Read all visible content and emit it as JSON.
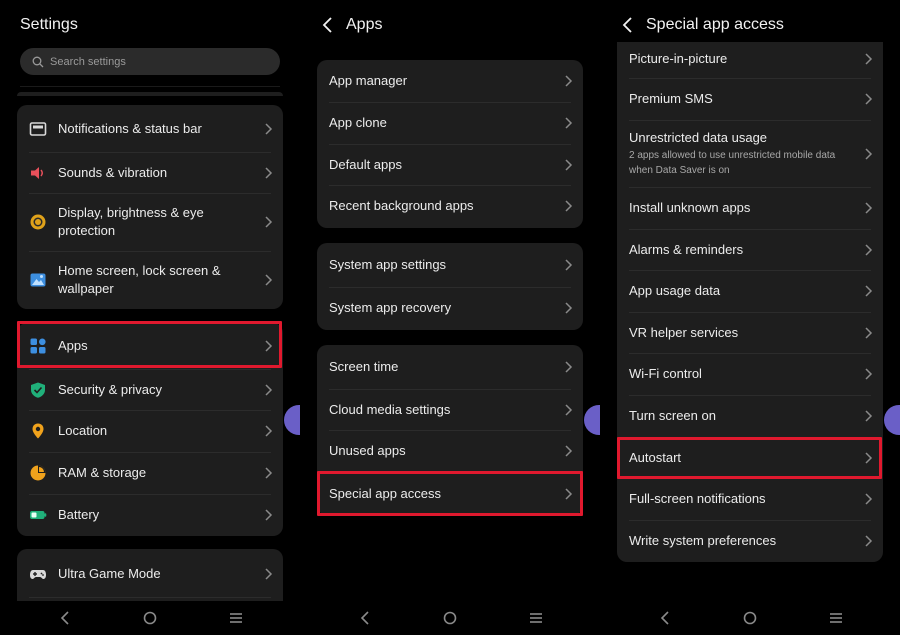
{
  "panel1": {
    "title": "Settings",
    "search_placeholder": "Search settings",
    "group1": [
      {
        "label": "Notifications & status bar",
        "icon": "notification-bar-icon"
      },
      {
        "label": "Sounds & vibration",
        "icon": "speaker-icon"
      },
      {
        "label": "Display, brightness & eye protection",
        "icon": "brightness-icon"
      },
      {
        "label": "Home screen, lock screen & wallpaper",
        "icon": "wallpaper-icon"
      }
    ],
    "group2": [
      {
        "label": "Apps",
        "icon": "apps-icon"
      },
      {
        "label": "Security & privacy",
        "icon": "shield-icon"
      },
      {
        "label": "Location",
        "icon": "location-pin-icon"
      },
      {
        "label": "RAM & storage",
        "icon": "storage-pie-icon"
      },
      {
        "label": "Battery",
        "icon": "battery-icon"
      }
    ],
    "group3": [
      {
        "label": "Ultra Game Mode",
        "icon": "gamepad-icon"
      }
    ]
  },
  "panel2": {
    "title": "Apps",
    "group1": [
      "App manager",
      "App clone",
      "Default apps",
      "Recent background apps"
    ],
    "group2": [
      "System app settings",
      "System app recovery"
    ],
    "group3": [
      "Screen time",
      "Cloud media settings",
      "Unused apps",
      "Special app access"
    ]
  },
  "panel3": {
    "title": "Special app access",
    "items": [
      {
        "label": "Picture-in-picture"
      },
      {
        "label": "Premium SMS"
      },
      {
        "label": "Unrestricted data usage",
        "sub": "2 apps allowed to use unrestricted mobile data when Data Saver is on"
      },
      {
        "label": "Install unknown apps"
      },
      {
        "label": "Alarms & reminders"
      },
      {
        "label": "App usage data"
      },
      {
        "label": "VR helper services"
      },
      {
        "label": "Wi-Fi control"
      },
      {
        "label": "Turn screen on"
      },
      {
        "label": "Autostart"
      },
      {
        "label": "Full-screen notifications"
      },
      {
        "label": "Write system preferences"
      }
    ]
  },
  "colors": {
    "highlight": "#e0192e",
    "card_bg": "#1e1e1e",
    "page_bg": "#000000",
    "floating_bubble": "#6a5fc7"
  }
}
